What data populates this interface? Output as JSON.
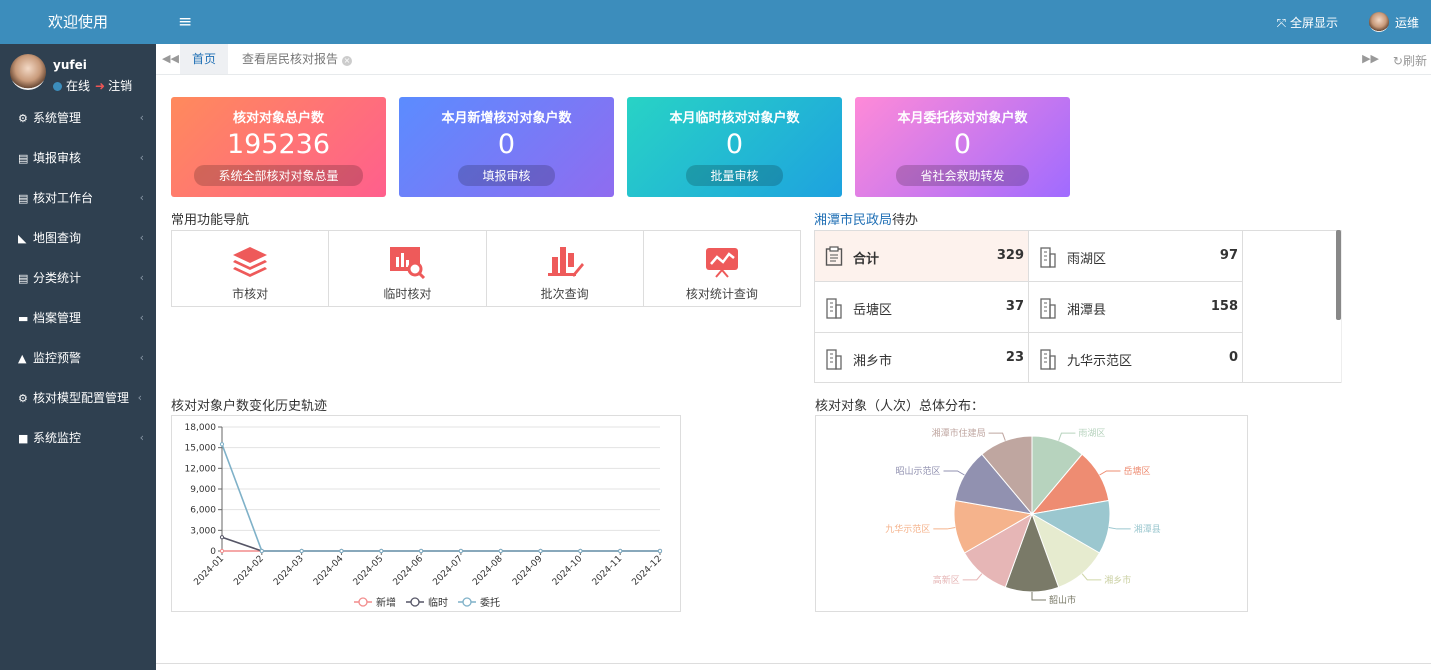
{
  "sidebar": {
    "logo": "欢迎使用",
    "user": {
      "name": "yufei",
      "status": "在线",
      "logout": "注销"
    },
    "items": [
      {
        "label": "系统管理",
        "icon": "gear-icon"
      },
      {
        "label": "填报审核",
        "icon": "id-card-icon"
      },
      {
        "label": "核对工作台",
        "icon": "id-card-icon"
      },
      {
        "label": "地图查询",
        "icon": "area-chart-icon"
      },
      {
        "label": "分类统计",
        "icon": "id-card-icon"
      },
      {
        "label": "档案管理",
        "icon": "archive-icon"
      },
      {
        "label": "监控预警",
        "icon": "warning-icon"
      },
      {
        "label": "核对模型配置管理",
        "icon": "cogs-icon"
      },
      {
        "label": "系统监控",
        "icon": "video-icon"
      }
    ]
  },
  "topbar": {
    "fullscreen": "全屏显示",
    "user": "运维"
  },
  "tabs": {
    "home": "首页",
    "report": "查看居民核对报告",
    "refresh": "刷新"
  },
  "cards": [
    {
      "title": "核对对象总户数",
      "value": "195236",
      "button": "系统全部核对对象总量"
    },
    {
      "title": "本月新增核对对象户数",
      "value": "0",
      "button": "填报审核"
    },
    {
      "title": "本月临时核对对象户数",
      "value": "0",
      "button": "批量审核"
    },
    {
      "title": "本月委托核对对象户数",
      "value": "0",
      "button": "省社会救助转发"
    }
  ],
  "nav": {
    "title": "常用功能导航",
    "items": [
      {
        "label": "市核对",
        "icon": "layers-icon"
      },
      {
        "label": "临时核对",
        "icon": "chart-search-icon"
      },
      {
        "label": "批次查询",
        "icon": "bar-edit-icon"
      },
      {
        "label": "核对统计查询",
        "icon": "presentation-chart-icon"
      }
    ]
  },
  "todo": {
    "title_link": "湘潭市民政局",
    "title_suffix": "待办",
    "items": [
      {
        "name": "合计",
        "value": "329",
        "icon": "clipboard-icon"
      },
      {
        "name": "雨湖区",
        "value": "97",
        "icon": "building-icon"
      },
      {
        "name": "岳塘区",
        "value": "37",
        "icon": "building-icon"
      },
      {
        "name": "湘潭县",
        "value": "158",
        "icon": "building-icon"
      },
      {
        "name": "湘乡市",
        "value": "23",
        "icon": "building-icon"
      },
      {
        "name": "九华示范区",
        "value": "0",
        "icon": "building-icon"
      }
    ]
  },
  "line_title": "核对对象户数变化历史轨迹",
  "pie_title": "核对对象（人次）总体分布：",
  "chart_data": [
    {
      "type": "line",
      "x": [
        "2024-01",
        "2024-02",
        "2024-03",
        "2024-04",
        "2024-05",
        "2024-06",
        "2024-07",
        "2024-08",
        "2024-09",
        "2024-10",
        "2024-11",
        "2024-12"
      ],
      "ylim": [
        0,
        18000
      ],
      "yticks": [
        "0",
        "3,000",
        "6,000",
        "9,000",
        "12,000",
        "15,000",
        "18,000"
      ],
      "series": [
        {
          "name": "新增",
          "color": "#f28c8c",
          "values": [
            0,
            0,
            0,
            0,
            0,
            0,
            0,
            0,
            0,
            0,
            0,
            0
          ]
        },
        {
          "name": "临时",
          "color": "#555566",
          "values": [
            2000,
            0,
            0,
            0,
            0,
            0,
            0,
            0,
            0,
            0,
            0,
            0
          ]
        },
        {
          "name": "委托",
          "color": "#7fb1c8",
          "values": [
            15500,
            0,
            0,
            0,
            0,
            0,
            0,
            0,
            0,
            0,
            0,
            0
          ]
        }
      ],
      "legend": "bottom"
    },
    {
      "type": "pie",
      "slices": [
        {
          "name": "雨湖区",
          "value": 1,
          "color": "#b7d3be"
        },
        {
          "name": "岳塘区",
          "value": 1,
          "color": "#ee8c72"
        },
        {
          "name": "湘潭县",
          "value": 1,
          "color": "#9bc7cf"
        },
        {
          "name": "湘乡市",
          "value": 1,
          "color": "#e6ebcf"
        },
        {
          "name": "韶山市",
          "value": 1,
          "color": "#7a7a68"
        },
        {
          "name": "高新区",
          "value": 1,
          "color": "#e6b6b6"
        },
        {
          "name": "九华示范区",
          "value": 1,
          "color": "#f5b38c"
        },
        {
          "name": "昭山示范区",
          "value": 1,
          "color": "#9191b0"
        },
        {
          "name": "湘潭市住建局",
          "value": 1,
          "color": "#bfa6a0"
        }
      ]
    }
  ]
}
